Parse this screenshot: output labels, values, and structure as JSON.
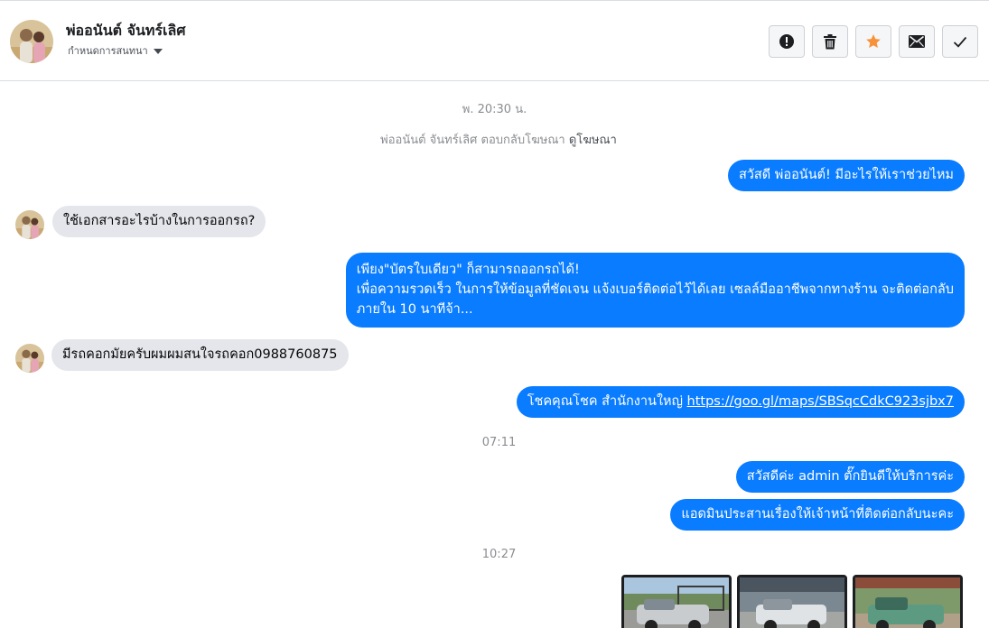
{
  "header": {
    "name": "พ่ออนันต์ จันทร์เลิศ",
    "subtitle": "กำหนดการสนทนา",
    "buttons": [
      {
        "icon": "exclamation-circle-icon"
      },
      {
        "icon": "trash-icon"
      },
      {
        "icon": "star-icon"
      },
      {
        "icon": "envelope-icon"
      },
      {
        "icon": "check-icon"
      }
    ]
  },
  "timestamps": {
    "t1": "พ. 20:30 น.",
    "t2": "07:11",
    "t3": "10:27"
  },
  "system_message": {
    "text": "พ่ออนันต์ จันทร์เลิศ ตอบกลับโฆษณา",
    "link": "ดูโฆษณา"
  },
  "messages": {
    "m1": "สวัสดี พ่ออนันต์! มีอะไรให้เราช่วยไหม",
    "m2": "ใช้เอกสารอะไรบ้างในการออกรถ?",
    "m3_line1": "เพียง\"บัตรใบเดียว\" ก็สามารถออกรถได้!",
    "m3_line2": "เพื่อความรวดเร็ว ในการให้ข้อมูลที่ชัดเจน แจ้งเบอร์ติดต่อไว้ได้เลย เซลล์มืออาชีพจากทางร้าน จะติดต่อกลับ",
    "m3_line3": "ภายใน 10 นาทีจ้า...",
    "m4": "มีรถคอกมัยครับผมผมสนใจรถคอก0988760875",
    "m5_text": "โชคคุณโชค สำนักงานใหญ่ ",
    "m5_link": "https://goo.gl/maps/SBSqcCdkC923sjbx7",
    "m6": "สวัสดีค่ะ admin ตั๊กยินดีให้บริการค่ะ",
    "m7": "แอดมินประสานเรื่องให้เจ้าหน้าที่ติดต่อกลับนะคะ"
  },
  "colors": {
    "outgoing_bubble": "#0a7cff",
    "incoming_bubble": "#e4e6eb",
    "star": "#f7923b"
  }
}
